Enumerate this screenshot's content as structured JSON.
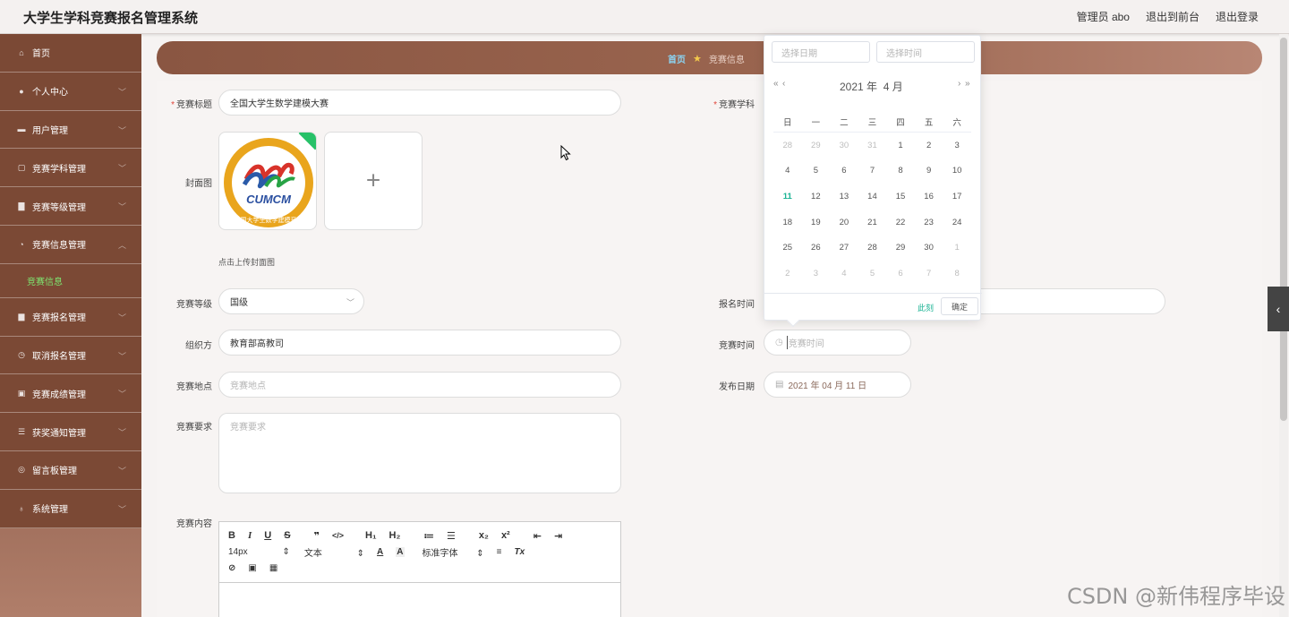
{
  "header": {
    "app_title": "大学生学科竞赛报名管理系统",
    "admin_label": "管理员 abo",
    "back_front": "退出到前台",
    "logout": "退出登录"
  },
  "sidebar": {
    "items": [
      {
        "label": "首页",
        "icon": "home-icon"
      },
      {
        "label": "个人中心",
        "icon": "user-icon"
      },
      {
        "label": "用户管理",
        "icon": "users-icon"
      },
      {
        "label": "竞赛学科管理",
        "icon": "book-icon"
      },
      {
        "label": "竞赛等级管理",
        "icon": "level-icon"
      },
      {
        "label": "竞赛信息管理",
        "icon": "info-icon"
      },
      {
        "label": "竞赛报名管理",
        "icon": "briefcase-icon"
      },
      {
        "label": "取消报名管理",
        "icon": "clock-icon"
      },
      {
        "label": "竞赛成绩管理",
        "icon": "grade-icon"
      },
      {
        "label": "获奖通知管理",
        "icon": "list-icon"
      },
      {
        "label": "留言板管理",
        "icon": "message-icon"
      },
      {
        "label": "系统管理",
        "icon": "mic-icon"
      }
    ],
    "active_sub": "竞赛信息"
  },
  "breadcrumb": {
    "home": "首页",
    "current": "竞赛信息"
  },
  "form": {
    "title_label": "竞赛标题",
    "title_value": "全国大学生数学建模大赛",
    "subject_label": "竞赛学科",
    "cover_label": "封面图",
    "cover_hint": "点击上传封面图",
    "cover_logo_text": "CUMCM",
    "cover_logo_ring": "中国大学生数学建模竞赛",
    "level_label": "竞赛等级",
    "level_value": "国级",
    "signup_time_label": "报名时间",
    "organizer_label": "组织方",
    "organizer_value": "教育部高教司",
    "comp_time_label": "竞赛时间",
    "comp_time_placeholder": "竞赛时间",
    "location_label": "竞赛地点",
    "location_placeholder": "竞赛地点",
    "publish_label": "发布日期",
    "publish_value": "2021 年 04 月 11 日",
    "requirement_label": "竞赛要求",
    "requirement_placeholder": "竞赛要求",
    "content_label": "竞赛内容"
  },
  "editor": {
    "font_size": "14px",
    "text_style": "文本",
    "font_family": "标准字体"
  },
  "datepicker": {
    "date_placeholder": "选择日期",
    "time_placeholder": "选择时间",
    "year": "2021 年",
    "month": "4 月",
    "weekdays": [
      "日",
      "一",
      "二",
      "三",
      "四",
      "五",
      "六"
    ],
    "weeks": [
      [
        "28",
        "29",
        "30",
        "31",
        "1",
        "2",
        "3"
      ],
      [
        "4",
        "5",
        "6",
        "7",
        "8",
        "9",
        "10"
      ],
      [
        "11",
        "12",
        "13",
        "14",
        "15",
        "16",
        "17"
      ],
      [
        "18",
        "19",
        "20",
        "21",
        "22",
        "23",
        "24"
      ],
      [
        "25",
        "26",
        "27",
        "28",
        "29",
        "30",
        "1"
      ],
      [
        "2",
        "3",
        "4",
        "5",
        "6",
        "7",
        "8"
      ]
    ],
    "today": "11",
    "now_label": "此刻",
    "ok_label": "确定"
  },
  "watermark": "CSDN @新伟程序毕设",
  "colors": {
    "sidebar_bg": "#7b4935",
    "accent_green": "#1bb394",
    "active_sub": "#7ee36f",
    "breadcrumb_bar": "#9b6650"
  }
}
